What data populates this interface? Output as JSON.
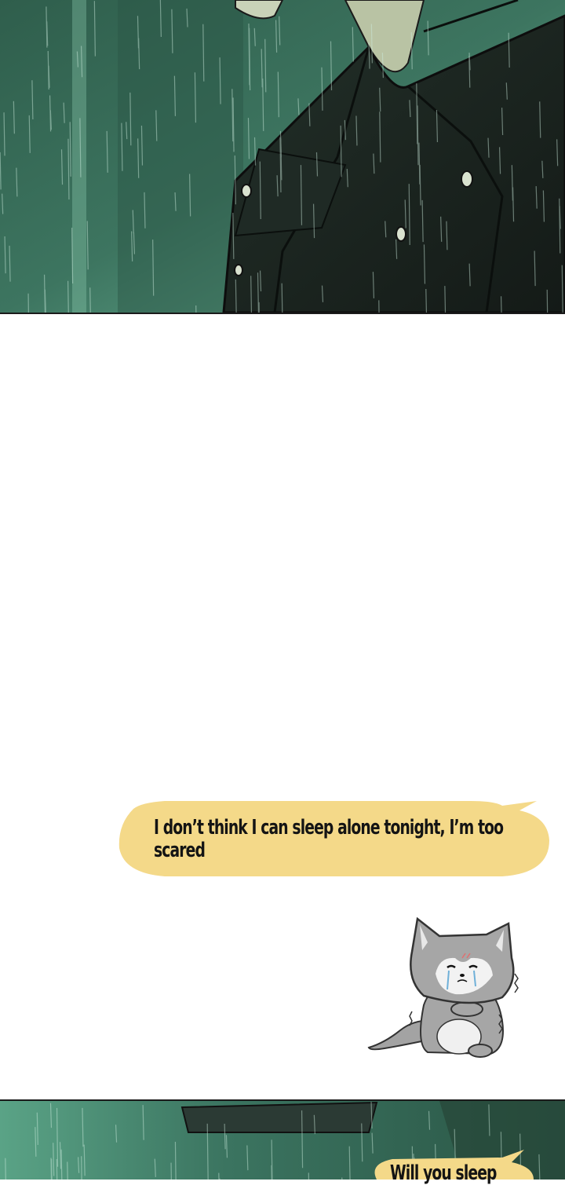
{
  "comic": {
    "speech_bubbles": [
      {
        "text": "I don’t think I can sleep alone tonight, I’m too scared"
      },
      {
        "text": "Will you sleep"
      }
    ]
  },
  "colors": {
    "rain_teal": "#3f7a64",
    "rain_dark": "#1e3a2e",
    "coat_black": "#1c2321",
    "bubble_yellow": "#f4d989",
    "wolf_gray": "#9a9a9a",
    "panel_border": "#1b1b1b"
  },
  "icons": {
    "mascot": "crying-gray-wolf-pup-icon"
  }
}
